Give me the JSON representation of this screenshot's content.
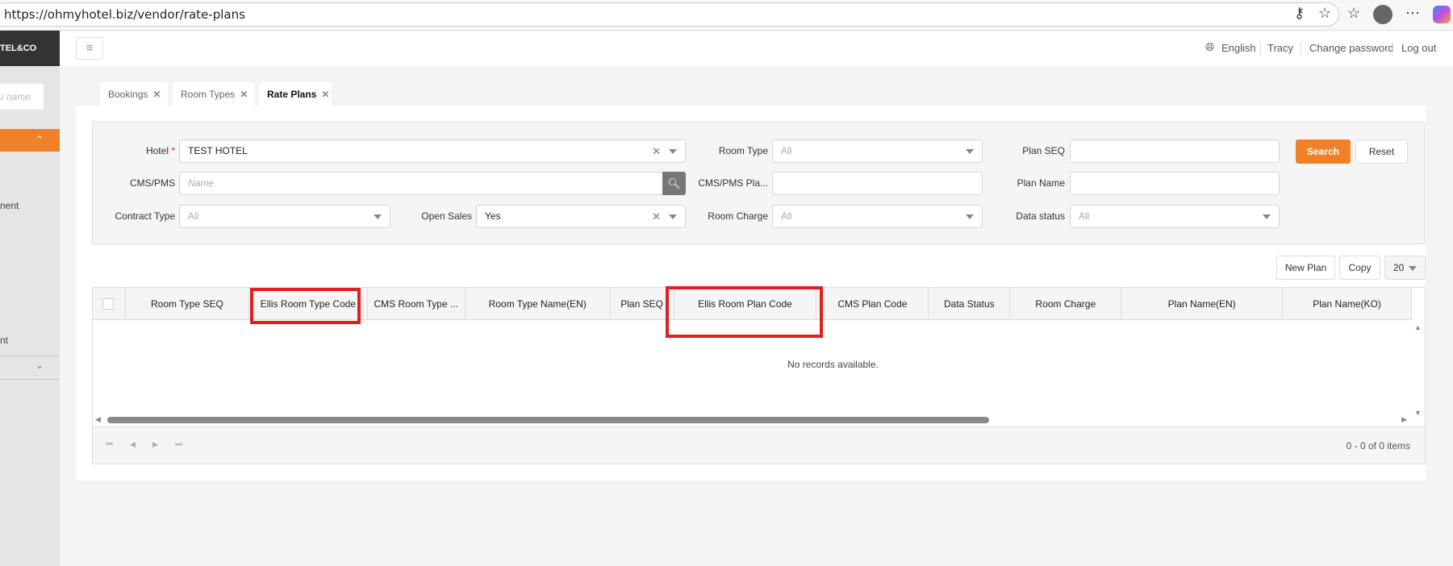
{
  "browser": {
    "url": "https://ohmyhotel.biz/vendor/rate-plans"
  },
  "sidebar": {
    "logo": "TEL&CO",
    "search_placeholder": "u name",
    "item1": "nent",
    "item2": "nt"
  },
  "header": {
    "language": "English",
    "user": "Tracy",
    "change_password": "Change password",
    "logout": "Log out"
  },
  "tabs": [
    {
      "label": "Bookings"
    },
    {
      "label": "Room Types"
    },
    {
      "label": "Rate Plans"
    }
  ],
  "filters": {
    "hotel": {
      "label": "Hotel",
      "required": "*",
      "value": "TEST HOTEL"
    },
    "cms_pms": {
      "label": "CMS/PMS",
      "placeholder": "Name"
    },
    "contract_type": {
      "label": "Contract Type",
      "value": "All"
    },
    "open_sales": {
      "label": "Open Sales",
      "value": "Yes"
    },
    "room_type": {
      "label": "Room Type",
      "value": "All"
    },
    "cms_pms_plan": {
      "label": "CMS/PMS Pla..."
    },
    "room_charge": {
      "label": "Room Charge",
      "value": "All"
    },
    "plan_seq": {
      "label": "Plan SEQ"
    },
    "plan_name": {
      "label": "Plan Name"
    },
    "data_status": {
      "label": "Data status",
      "value": "All"
    },
    "search": "Search",
    "reset": "Reset"
  },
  "toolbar": {
    "new_plan": "New Plan",
    "copy": "Copy",
    "page_size": "20"
  },
  "table": {
    "columns": [
      "Room Type SEQ",
      "Ellis Room Type Code",
      "CMS Room Type ...",
      "Room Type Name(EN)",
      "Plan SEQ",
      "Ellis Room Plan Code",
      "CMS Plan Code",
      "Data Status",
      "Room Charge",
      "Plan Name(EN)",
      "Plan Name(KO)"
    ],
    "empty": "No records available."
  },
  "pager": {
    "summary": "0 - 0 of 0 items"
  },
  "colors": {
    "accent": "#f08129",
    "highlight": "#e02020"
  }
}
